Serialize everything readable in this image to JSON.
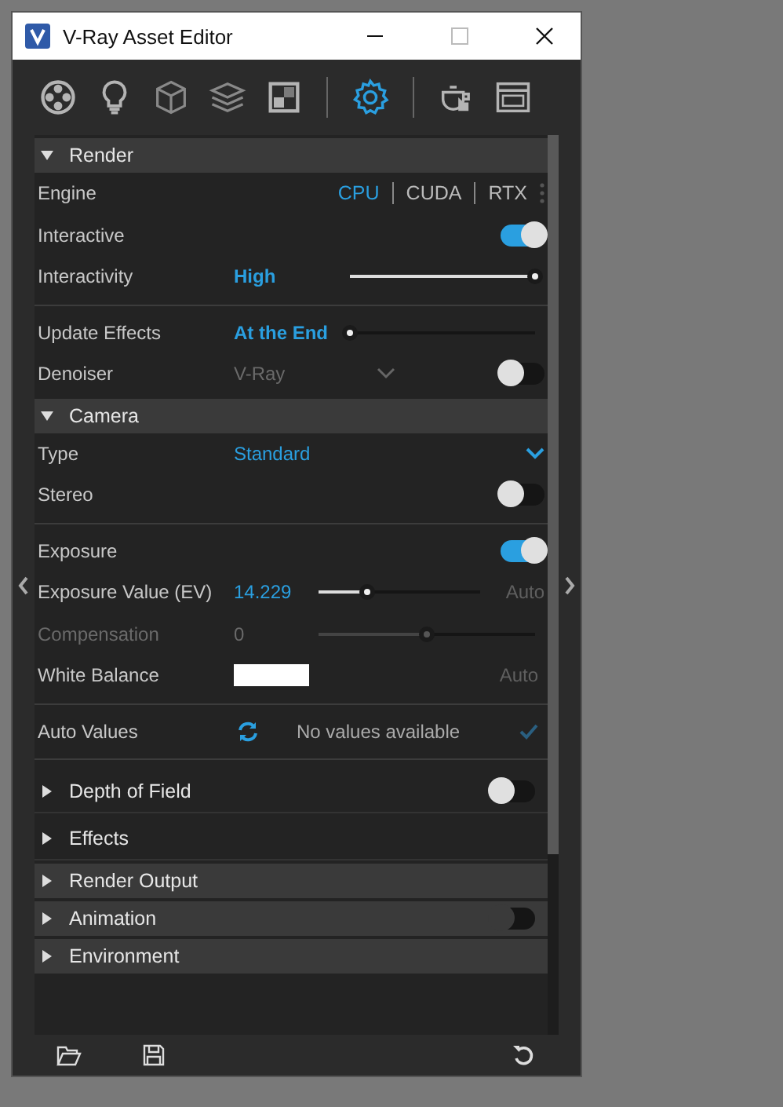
{
  "window": {
    "title": "V-Ray Asset Editor"
  },
  "toolbar": [
    {
      "selected": false
    },
    {
      "selected": false
    },
    {
      "selected": false
    },
    {
      "selected": false
    },
    {
      "selected": false
    },
    {
      "selected": true
    },
    {
      "selected": false
    },
    {
      "selected": false
    }
  ],
  "sections": [
    {
      "kind": "section",
      "title": "Render",
      "expanded": true,
      "rows": [
        {
          "kind": "engine",
          "label": "Engine",
          "options": [
            {
              "label": "CPU",
              "selected": true
            },
            {
              "label": "CUDA",
              "selected": false
            },
            {
              "label": "RTX",
              "selected": false
            }
          ]
        },
        {
          "kind": "toggle",
          "label": "Interactive",
          "on": true
        },
        {
          "kind": "slider",
          "label": "Interactivity",
          "value": "High",
          "bold": true,
          "level": 1
        },
        {
          "kind": "divider"
        },
        {
          "kind": "slider",
          "label": "Update Effects",
          "value": "At the End",
          "bold": true,
          "level": 0
        },
        {
          "kind": "dropdown-toggle",
          "label": "Denoiser",
          "value": "V-Ray",
          "on": false
        }
      ]
    },
    {
      "kind": "section",
      "title": "Camera",
      "expanded": true,
      "rows": [
        {
          "kind": "dropdown",
          "label": "Type",
          "value": "Standard"
        },
        {
          "kind": "toggle",
          "label": "Stereo",
          "on": false
        },
        {
          "kind": "divider"
        },
        {
          "kind": "toggle",
          "label": "Exposure",
          "on": true
        },
        {
          "kind": "slider",
          "label": "Exposure Value (EV)",
          "value": "14.229",
          "level": 0.3,
          "suffix": "Auto"
        },
        {
          "kind": "slider",
          "label": "Compensation",
          "value": "0",
          "level": 0.5,
          "disabled": true
        },
        {
          "kind": "color",
          "label": "White Balance",
          "color": "#ffffff",
          "suffix": "Auto"
        },
        {
          "kind": "divider"
        },
        {
          "kind": "auto-values",
          "label": "Auto Values",
          "value": "No values available"
        },
        {
          "kind": "divider"
        }
      ]
    },
    {
      "kind": "subsection",
      "title": "Depth of Field",
      "expanded": false,
      "on": false
    },
    {
      "kind": "subsection",
      "title": "Effects",
      "expanded": false
    },
    {
      "kind": "section",
      "title": "Render Output",
      "expanded": false
    },
    {
      "kind": "section",
      "title": "Animation",
      "expanded": false,
      "on": false
    },
    {
      "kind": "section",
      "title": "Environment",
      "expanded": false
    }
  ]
}
